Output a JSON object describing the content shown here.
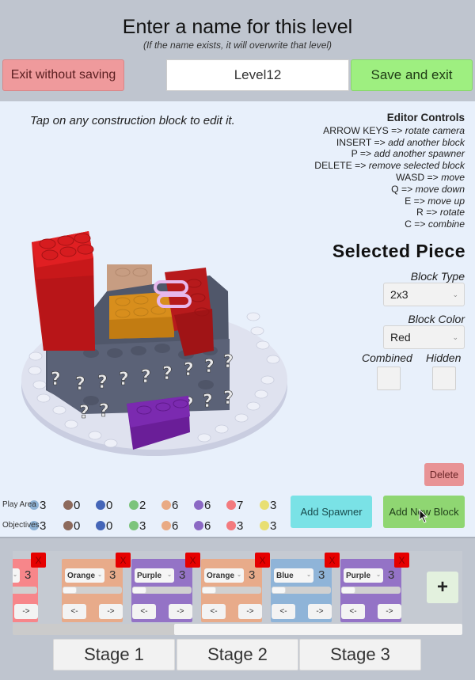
{
  "header": {
    "title": "Enter a name for this level",
    "subtitle": "(If the name exists, it will overwrite that level)",
    "exit_label": "Exit without saving",
    "level_name_value": "Level12",
    "save_label": "Save and exit"
  },
  "editor": {
    "hint": "Tap on any construction block to edit it.",
    "controls": {
      "title": "Editor Controls",
      "items": [
        {
          "key": "ARROW KEYS =>",
          "desc": "rotate camera"
        },
        {
          "key": "INSERT  =>",
          "desc": "add another block"
        },
        {
          "key": "P =>",
          "desc": "add another spawner"
        },
        {
          "key": "DELETE =>",
          "desc": "remove selected block"
        },
        {
          "key": "WASD =>",
          "desc": "move"
        },
        {
          "key": "Q =>",
          "desc": "move down"
        },
        {
          "key": "E =>",
          "desc": "move up"
        },
        {
          "key": "R =>",
          "desc": "rotate"
        },
        {
          "key": "C =>",
          "desc": "combine"
        }
      ]
    },
    "selected_piece": {
      "title": "Selected Piece",
      "block_type_label": "Block Type",
      "block_type_value": "2x3",
      "block_color_label": "Block Color",
      "block_color_value": "Red",
      "combined_label": "Combined",
      "combined_checked": false,
      "hidden_label": "Hidden",
      "hidden_checked": false
    },
    "delete_label": "Delete",
    "add_spawner_label": "Add Spawner",
    "add_block_label": "Add New Block",
    "counts": {
      "colors": [
        "#8fb3d6",
        "#8d6a5c",
        "#4566b8",
        "#7cc47c",
        "#e9aa84",
        "#8b69c4",
        "#f37a7e",
        "#e8df72"
      ],
      "play_area_label": "Play Area",
      "play_area": [
        "3",
        "0",
        "0",
        "2",
        "6",
        "6",
        "7",
        "3"
      ],
      "objectives_label": "Objectives",
      "objectives": [
        "3",
        "0",
        "0",
        "3",
        "6",
        "6",
        "3",
        "3"
      ]
    }
  },
  "spawners": {
    "items": [
      {
        "color": "",
        "count": "3",
        "bg": "#f7868a",
        "left_label": "<-",
        "right_label": "->",
        "close_label": "X"
      },
      {
        "color": "Orange",
        "count": "3",
        "bg": "#e8ab8a",
        "left_label": "<-",
        "right_label": "->",
        "close_label": "X"
      },
      {
        "color": "Purple",
        "count": "3",
        "bg": "#9473c6",
        "left_label": "<-",
        "right_label": "->",
        "close_label": "X"
      },
      {
        "color": "Orange",
        "count": "3",
        "bg": "#e8ab8a",
        "left_label": "<-",
        "right_label": "->",
        "close_label": "X"
      },
      {
        "color": "Blue",
        "count": "3",
        "bg": "#8fb4d8",
        "left_label": "<-",
        "right_label": "->",
        "close_label": "X"
      },
      {
        "color": "Purple",
        "count": "3",
        "bg": "#9473c6",
        "left_label": "<-",
        "right_label": "->",
        "close_label": "X"
      }
    ],
    "add_label": "+"
  },
  "stages": [
    "Stage 1",
    "Stage 2",
    "Stage 3"
  ]
}
